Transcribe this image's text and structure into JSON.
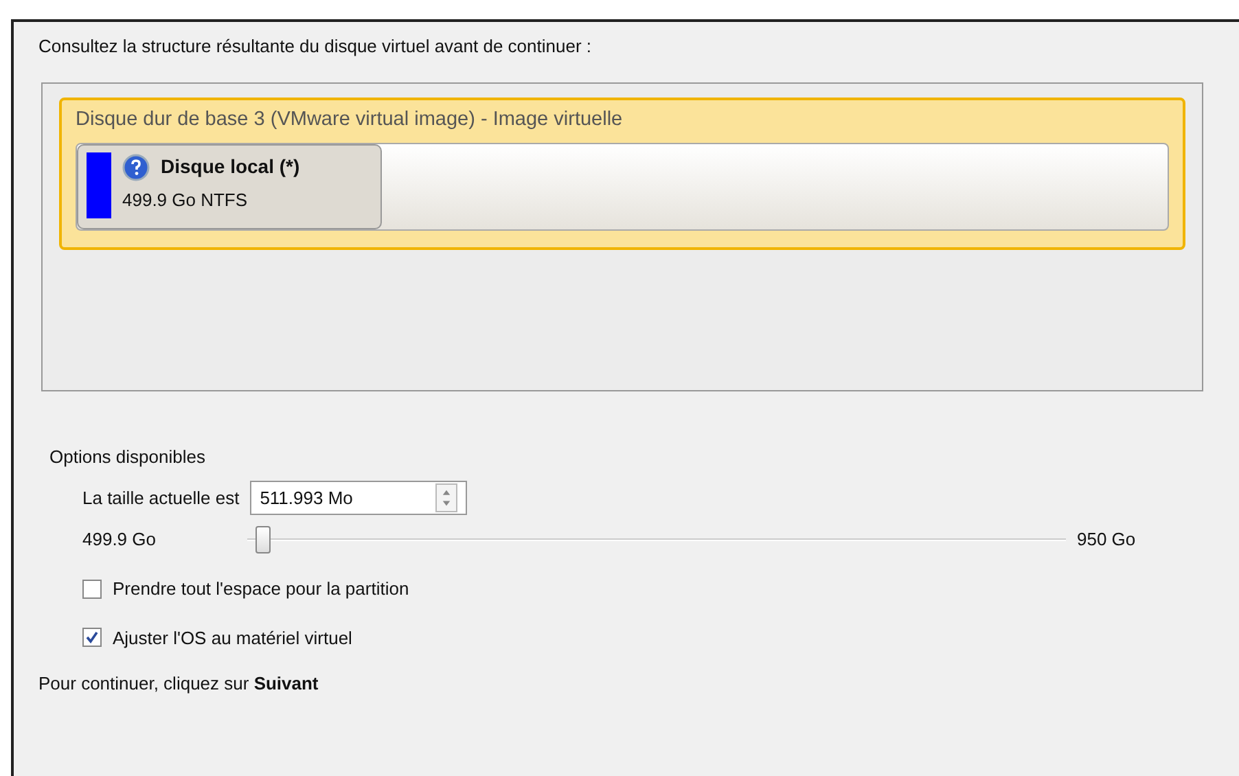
{
  "instruction": "Consultez la structure résultante du disque virtuel avant de continuer :",
  "disk": {
    "title": "Disque dur de base 3 (VMware virtual image) - Image virtuelle",
    "selected": true,
    "partitions": [
      {
        "name": "Disque local (*)",
        "info": "499.9 Go NTFS",
        "color": "#0000ff"
      }
    ]
  },
  "options": {
    "heading": "Options disponibles",
    "size": {
      "label": "La taille actuelle est",
      "value": "511.993 Mo"
    },
    "slider": {
      "min_label": "499.9 Go",
      "max_label": "950 Go",
      "level": 0.01
    },
    "checkboxes": [
      {
        "label": "Prendre tout l'espace pour la partition",
        "checked": false
      },
      {
        "label": "Ajuster l'OS au matériel virtuel",
        "checked": true
      }
    ]
  },
  "footer": "Pour continuer, cliquez sur **Suivant**"
}
